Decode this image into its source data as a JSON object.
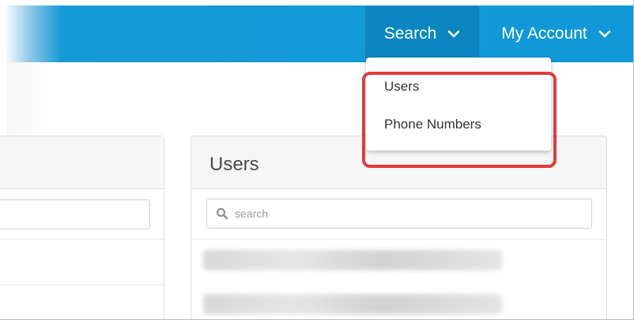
{
  "nav": {
    "search_label": "Search",
    "account_label": "My Account"
  },
  "dropdown": {
    "items": [
      {
        "label": "Users"
      },
      {
        "label": "Phone Numbers"
      }
    ]
  },
  "users_panel": {
    "title": "Users",
    "search_placeholder": "search"
  },
  "colors": {
    "topbar": "#0f98d8",
    "active_nav": "#0b86c0",
    "highlight": "#e23b3b"
  }
}
